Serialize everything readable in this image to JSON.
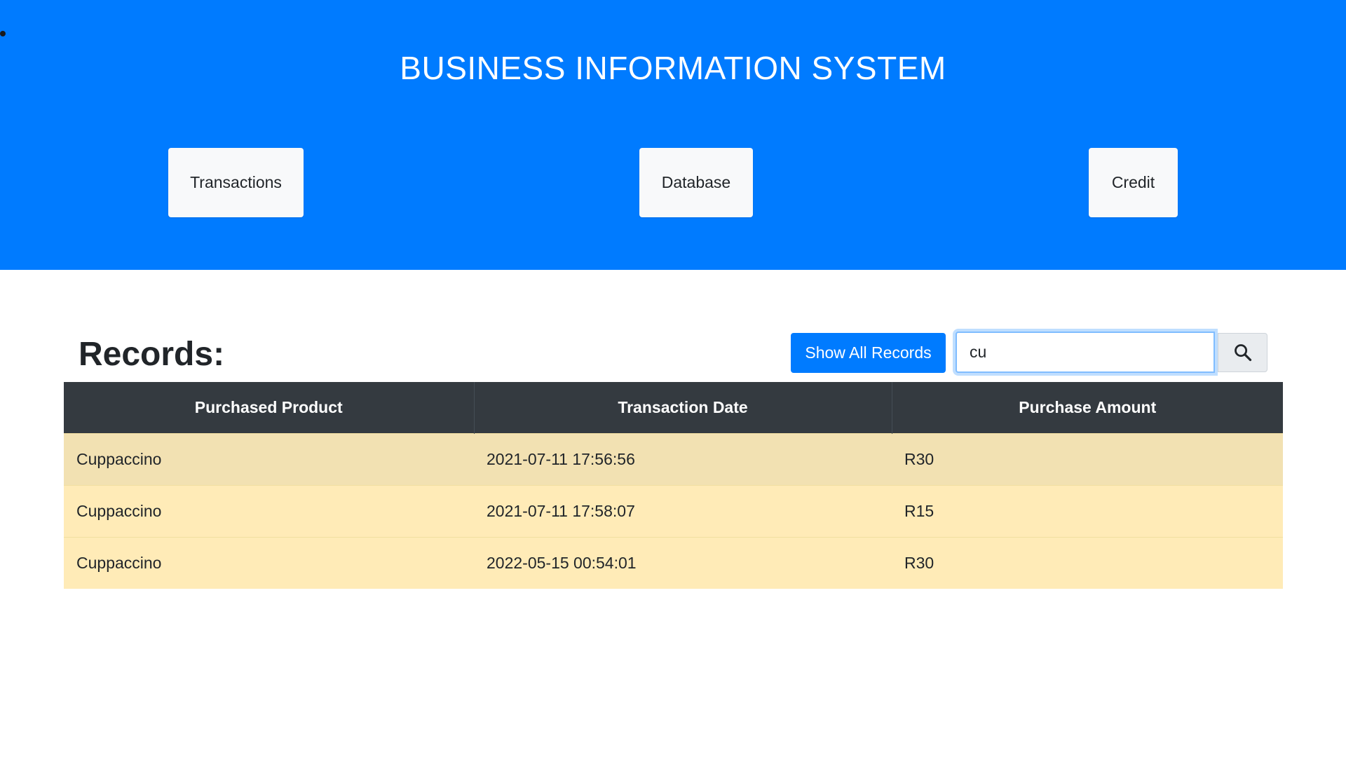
{
  "header": {
    "title": "BUSINESS INFORMATION SYSTEM",
    "background_color": "#007bff",
    "nav": [
      {
        "label": "Transactions"
      },
      {
        "label": "Database"
      },
      {
        "label": "Credit"
      }
    ]
  },
  "records": {
    "heading": "Records:",
    "show_all_label": "Show All Records",
    "search": {
      "value": "cu",
      "icon": "search-icon"
    },
    "columns": [
      "Purchased Product",
      "Transaction Date",
      "Purchase Amount"
    ],
    "rows": [
      {
        "product": "Cuppaccino",
        "date": "2021-07-11 17:56:56",
        "amount": "R30"
      },
      {
        "product": "Cuppaccino",
        "date": "2021-07-11 17:58:07",
        "amount": "R15"
      },
      {
        "product": "Cuppaccino",
        "date": "2022-05-15 00:54:01",
        "amount": "R30"
      }
    ]
  },
  "colors": {
    "accent": "#007bff",
    "table_header": "#343a40",
    "row_highlight": "#ffebb7"
  }
}
